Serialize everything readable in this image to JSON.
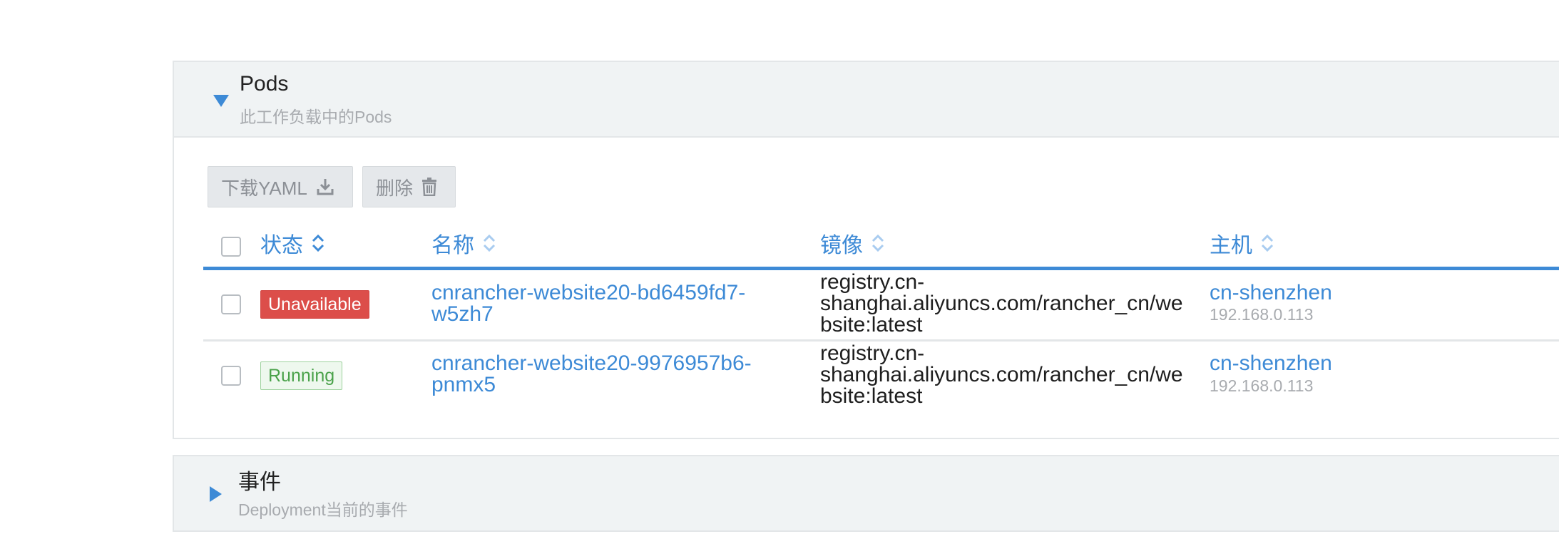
{
  "pods_section": {
    "title": "Pods",
    "subtitle": "此工作负载中的Pods",
    "toolbar": {
      "download_label": "下载YAML",
      "delete_label": "删除"
    },
    "table": {
      "headers": {
        "state": "状态",
        "name": "名称",
        "image": "镜像",
        "node": "主机"
      },
      "rows": [
        {
          "state": "Unavailable",
          "name_line1": "cnrancher-website20-bd6459fd7-",
          "name_line2": "w5zh7",
          "image_line1": "registry.cn-",
          "image_line2": "shanghai.aliyuncs.com/rancher_cn/we",
          "image_line3": "bsite:latest",
          "node": "cn-shenzhen",
          "node_ip": "192.168.0.113"
        },
        {
          "state": "Running",
          "name_line1": "cnrancher-website20-9976957b6-",
          "name_line2": "pnmx5",
          "image_line1": "registry.cn-",
          "image_line2": "shanghai.aliyuncs.com/rancher_cn/we",
          "image_line3": "bsite:latest",
          "node": "cn-shenzhen",
          "node_ip": "192.168.0.113"
        }
      ]
    }
  },
  "events_section": {
    "title": "事件",
    "subtitle": "Deployment当前的事件"
  },
  "colors": {
    "accent": "#3d8ad6",
    "error": "#dc4e4a",
    "success": "#4aa24a",
    "panel_bg": "#f0f3f4",
    "muted_text": "#a8abaf"
  },
  "icons": [
    "expand-triangle-icon",
    "download-icon",
    "trash-icon",
    "sort-icon",
    "collapse-triangle-icon"
  ]
}
